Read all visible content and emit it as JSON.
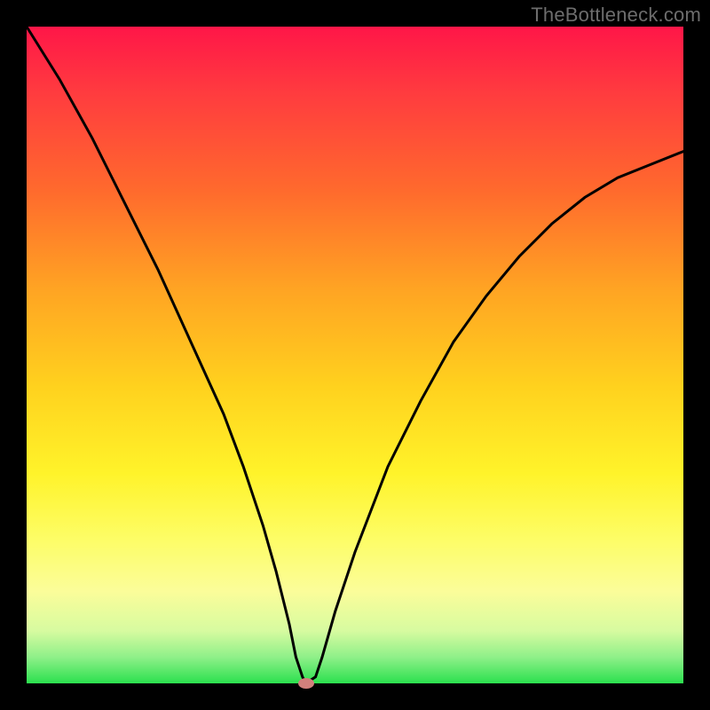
{
  "watermark": "TheBottleneck.com",
  "colors": {
    "frame": "#000000",
    "curve": "#000000",
    "marker": "#d1807c"
  },
  "chart_data": {
    "type": "line",
    "title": "",
    "xlabel": "",
    "ylabel": "",
    "xlim": [
      0,
      100
    ],
    "ylim": [
      0,
      100
    ],
    "grid": false,
    "series": [
      {
        "name": "bottleneck-curve",
        "x": [
          0,
          5,
          10,
          15,
          20,
          25,
          30,
          33,
          36,
          38,
          40,
          41,
          42,
          42.5,
          44,
          45,
          47,
          50,
          55,
          60,
          65,
          70,
          75,
          80,
          85,
          90,
          95,
          100
        ],
        "values": [
          100,
          92,
          83,
          73,
          63,
          52,
          41,
          33,
          24,
          17,
          9,
          4,
          1,
          0,
          1,
          4,
          11,
          20,
          33,
          43,
          52,
          59,
          65,
          70,
          74,
          77,
          79,
          81
        ]
      }
    ],
    "marker": {
      "x": 42.5,
      "y": 0
    },
    "gradient_stops": [
      {
        "pos": 0,
        "color": "#ff1648"
      },
      {
        "pos": 25,
        "color": "#ff6a2d"
      },
      {
        "pos": 55,
        "color": "#ffd21e"
      },
      {
        "pos": 78,
        "color": "#fdfd66"
      },
      {
        "pos": 96,
        "color": "#8ff089"
      },
      {
        "pos": 100,
        "color": "#2be04e"
      }
    ]
  }
}
